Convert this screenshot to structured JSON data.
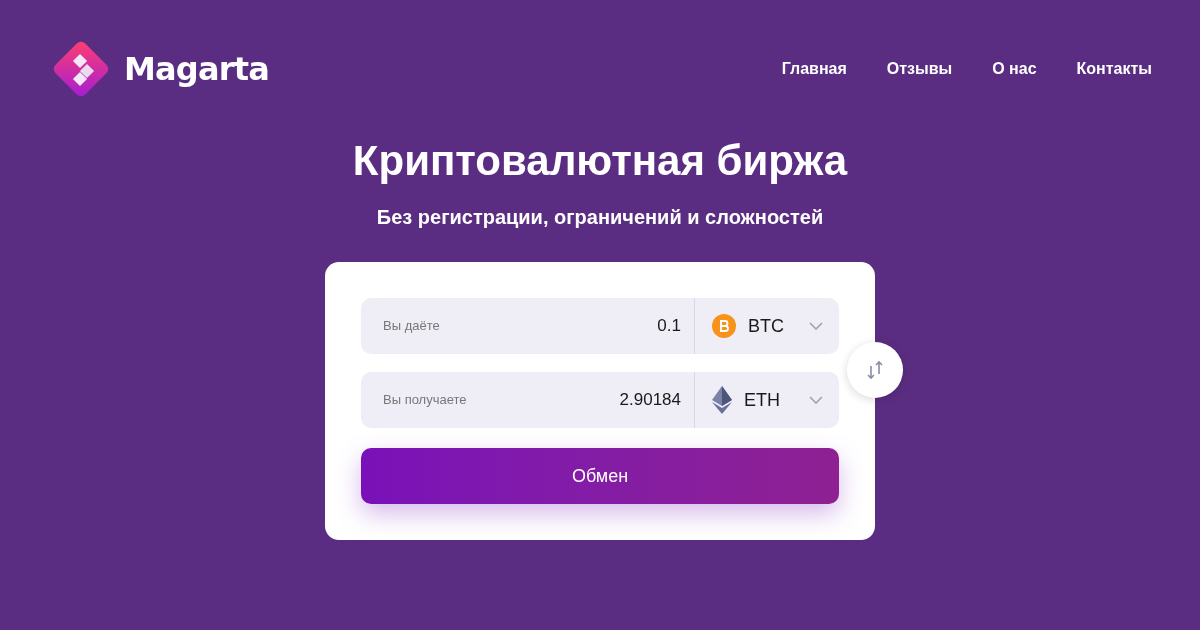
{
  "header": {
    "logo_text": "Magarta",
    "nav": [
      {
        "label": "Главная"
      },
      {
        "label": "Отзывы"
      },
      {
        "label": "О нас"
      },
      {
        "label": "Контакты"
      }
    ]
  },
  "hero": {
    "title": "Криптовалютная биржа",
    "subtitle": "Без регистрации, ограничений и сложностей"
  },
  "exchange": {
    "rows": [
      {
        "label": "Вы даёте",
        "value": "0.1",
        "currency": "BTC",
        "kind": "bitcoin"
      },
      {
        "label": "Вы получаете",
        "value": "2.90184",
        "currency": "ETH",
        "kind": "ethereum"
      }
    ],
    "submit": "Обмен"
  }
}
